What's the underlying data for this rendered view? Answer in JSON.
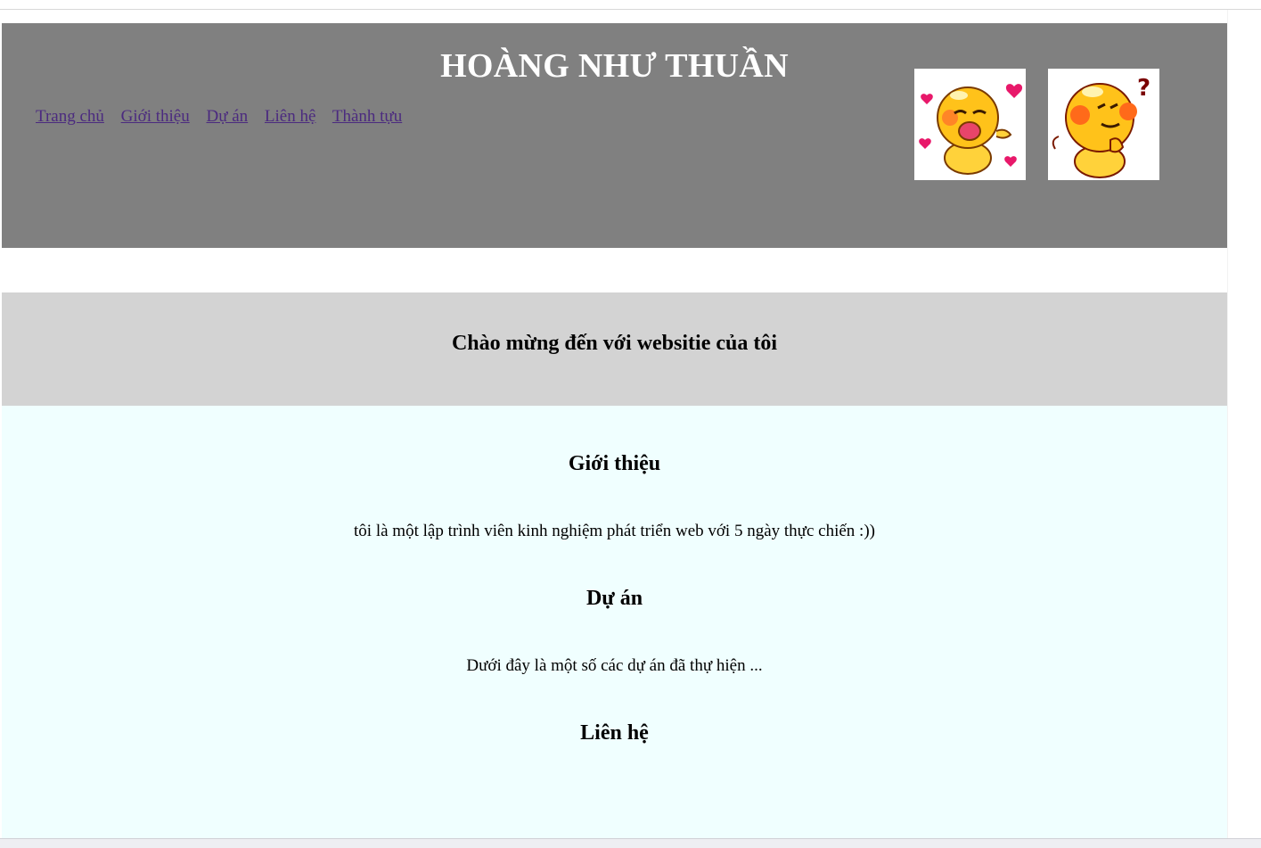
{
  "header": {
    "title": "HOÀNG NHƯ THUẦN",
    "nav": [
      "Trang chủ",
      "Giới thiệu",
      "Dự án",
      "Liên hệ",
      "Thành tựu"
    ],
    "stickers": [
      "love-sticker-icon",
      "thinking-sticker-icon"
    ]
  },
  "welcome": {
    "heading": "Chào mừng đến với websitie của tôi"
  },
  "sections": {
    "intro_heading": "Giới thiệu",
    "intro_text": "tôi là một lập trình viên kinh nghiệm phát triển web với 5 ngày thực chiến :))",
    "projects_heading": "Dự án",
    "projects_text": "Dưới đây là một số các dự án đã thự hiện ...",
    "contact_heading": "Liên hệ"
  },
  "colors": {
    "header_bg": "#808080",
    "welcome_bg": "#d3d3d3",
    "content_bg": "#f0ffff",
    "link": "#4b2a7f"
  }
}
